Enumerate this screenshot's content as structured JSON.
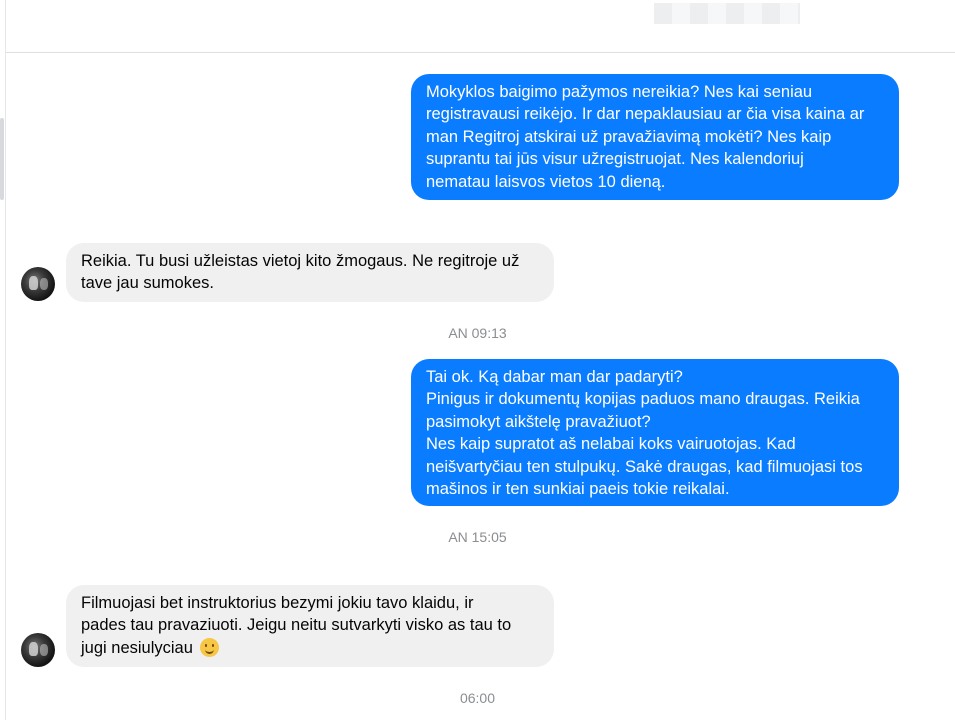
{
  "conversation": {
    "contact_name_blurred": true,
    "accent_color": "#0a7cff",
    "messages": [
      {
        "sender": "me",
        "text": "Mokyklos baigimo pažymos nereikia? Nes kai seniau\nregistravausi reikėjo. Ir dar nepaklausiau ar čia visa kaina ar\nman Regitroj atskirai už pravažiavimą mokėti? Nes kaip\nsuprantu tai jūs visur užregistruojat. Nes kalendoriuj\nnematau laisvos vietos 10 dieną."
      },
      {
        "sender": "them",
        "text": "Reikia. Tu busi užleistas vietoj kito žmogaus. Ne regitroje už\ntave jau sumokes."
      },
      {
        "sender": "me",
        "text": "Tai ok. Ką dabar man dar padaryti?\nPinigus ir dokumentų kopijas paduos mano draugas. Reikia\npasimokyt aikštelę pravažiuot?\nNes kaip supratot aš nelabai koks vairuotojas. Kad\nneišvartyčiau ten stulpukų. Sakė draugas, kad filmuojasi tos\nmašinos ir ten sunkiai paeis tokie reikalai."
      },
      {
        "sender": "them",
        "text": "Filmuojasi bet instruktorius bezymi jokiu tavo klaidu, ir\npades tau pravaziuoti. Jeigu neitu sutvarkyti visko as tau to\njugi nesiulyciau",
        "emoji": "slightly-smiling-face"
      }
    ],
    "timestamps": [
      "AN 09:13",
      "AN 15:05",
      "06:00"
    ]
  }
}
